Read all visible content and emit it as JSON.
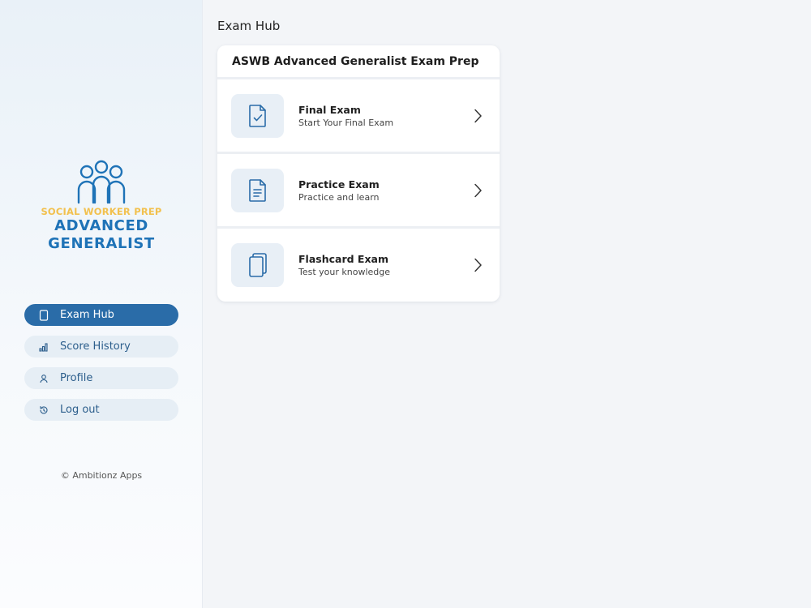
{
  "page": {
    "title": "Exam Hub"
  },
  "logo": {
    "tagline": "SOCIAL WORKER PREP",
    "line1": "ADVANCED",
    "line2": "GENERALIST",
    "primary_color": "#1f73b7",
    "accent_color": "#f2c14e"
  },
  "sidebar": {
    "items": [
      {
        "label": "Exam Hub",
        "icon": "tablet-icon",
        "active": true
      },
      {
        "label": "Score History",
        "icon": "bar-chart-icon",
        "active": false
      },
      {
        "label": "Profile",
        "icon": "user-icon",
        "active": false
      },
      {
        "label": "Log out",
        "icon": "refresh-icon",
        "active": false
      }
    ],
    "copyright": "© Ambitionz Apps"
  },
  "card": {
    "title": "ASWB Advanced Generalist Exam Prep",
    "exams": [
      {
        "title": "Final Exam",
        "subtitle": "Start Your Final Exam",
        "icon": "document-check-icon"
      },
      {
        "title": "Practice Exam",
        "subtitle": "Practice and learn",
        "icon": "document-lines-icon"
      },
      {
        "title": "Flashcard Exam",
        "subtitle": "Test your knowledge",
        "icon": "cards-stack-icon"
      }
    ]
  },
  "colors": {
    "active_nav": "#2a6ca8",
    "nav_bg": "#e6eef5",
    "icon_stroke": "#2a6ca8"
  }
}
